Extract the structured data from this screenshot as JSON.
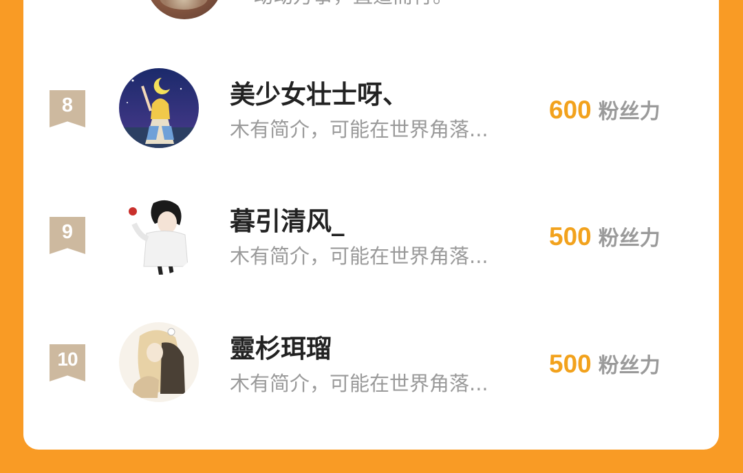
{
  "previous_entry": {
    "description": "动动万事，直道而行。"
  },
  "entries": [
    {
      "rank": "8",
      "name": "美少女壮士呀、",
      "description": "木有简介，可能在世界角落...",
      "fans_count": "600",
      "fans_unit": "粉丝力",
      "avatar": "avatar-sailor-moon-night"
    },
    {
      "rank": "9",
      "name": "暮引清风_",
      "description": "木有简介，可能在世界角落...",
      "fans_count": "500",
      "fans_unit": "粉丝力",
      "avatar": "avatar-boy-with-apple"
    },
    {
      "rank": "10",
      "name": "靈杉珥瑠",
      "description": "木有简介，可能在世界角落...",
      "fans_count": "500",
      "fans_unit": "粉丝力",
      "avatar": "avatar-anime-girl-sepia"
    }
  ],
  "colors": {
    "page_background": "#f99b25",
    "card_background": "#ffffff",
    "rank_badge": "#cdb99f",
    "fans_number": "#f2a21d",
    "muted_text": "#9a9a9a",
    "name_text": "#222222"
  }
}
